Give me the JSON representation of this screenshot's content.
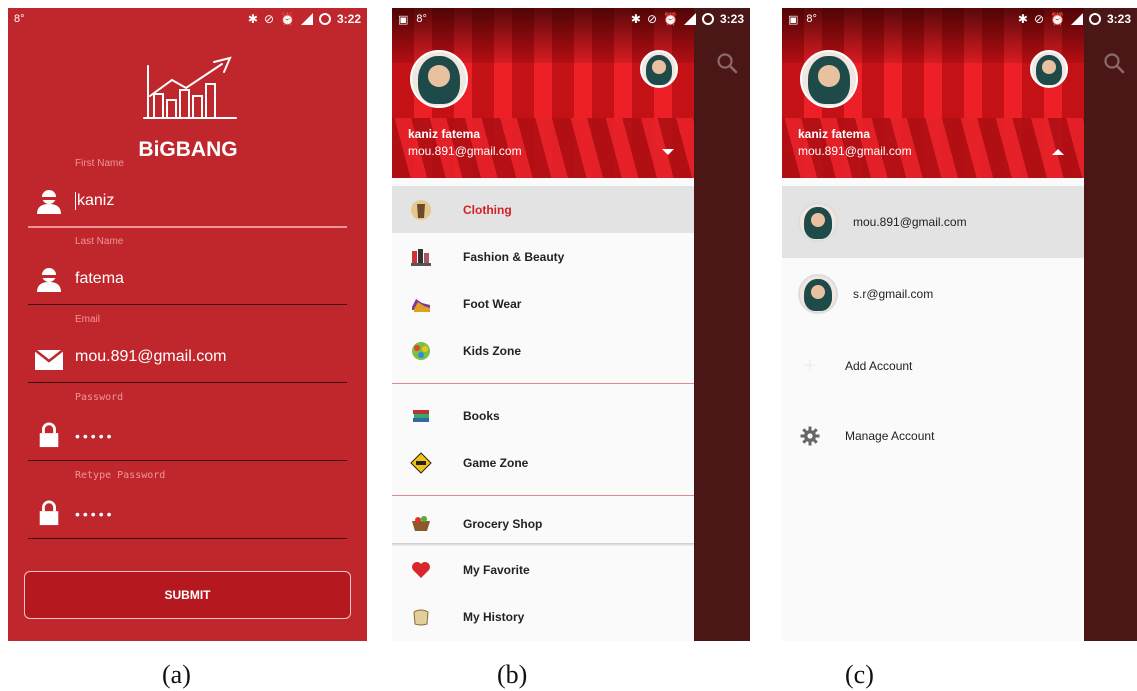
{
  "captions": {
    "a": "(a)",
    "b": "(b)",
    "c": "(c)"
  },
  "status": {
    "a": {
      "temp": "8°",
      "time": "3:22"
    },
    "b": {
      "temp": "8°",
      "time": "3:23"
    },
    "c": {
      "temp": "8°",
      "time": "3:23"
    }
  },
  "registration": {
    "logo_text": "BiGBANG",
    "fields": [
      {
        "label": "First Name",
        "value": "kaniz",
        "icon": "person-icon"
      },
      {
        "label": "Last Name",
        "value": "fatema",
        "icon": "person-icon"
      },
      {
        "label": "Email",
        "value": "mou.891@gmail.com",
        "icon": "mail-icon"
      },
      {
        "label": "Password",
        "value": "•••••",
        "icon": "lock-icon"
      },
      {
        "label": "Retype Password",
        "value": "•••••",
        "icon": "lock-icon"
      }
    ],
    "submit_label": "SUBMIT"
  },
  "drawer": {
    "user_name": "kaniz fatema",
    "user_email": "mou.891@gmail.com",
    "menu": [
      {
        "label": "Clothing",
        "icon": "clothing-icon",
        "selected": true
      },
      {
        "label": "Fashion & Beauty",
        "icon": "fashion-icon"
      },
      {
        "label": "Foot Wear",
        "icon": "footwear-icon"
      },
      {
        "label": "Kids Zone",
        "icon": "kids-icon"
      },
      {
        "label": "Books",
        "icon": "books-icon"
      },
      {
        "label": "Game Zone",
        "icon": "game-zone-icon"
      },
      {
        "label": "Grocery Shop",
        "icon": "grocery-icon"
      },
      {
        "label": "My Favorite",
        "icon": "heart-icon"
      },
      {
        "label": "My History",
        "icon": "history-icon"
      }
    ]
  },
  "accounts": {
    "user_name": "kaniz fatema",
    "user_email": "mou.891@gmail.com",
    "list": [
      {
        "email": "mou.891@gmail.com"
      },
      {
        "email": "s.r@gmail.com"
      }
    ],
    "add_account_label": "Add Account",
    "manage_account_label": "Manage Account"
  },
  "colors": {
    "brand_red": "#c0272d",
    "selected_text": "#d32027",
    "scrim": "#4b1616"
  }
}
